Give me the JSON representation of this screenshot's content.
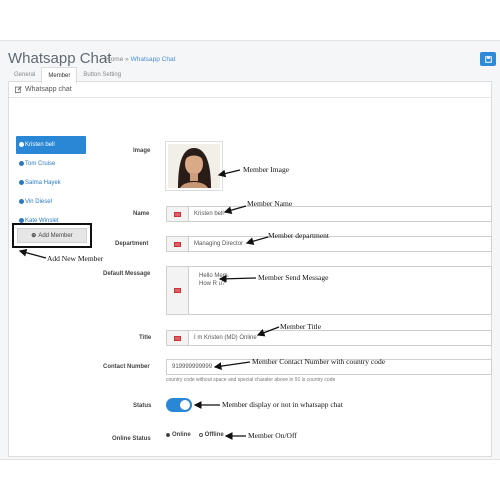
{
  "header": {
    "title": "Whatsapp Chat",
    "breadcrumb_home": "Home",
    "breadcrumb_sep": "»",
    "breadcrumb_current": "Whatsapp Chat"
  },
  "panel": {
    "title": "Whatsapp chat"
  },
  "tabs": [
    {
      "label": "General"
    },
    {
      "label": "Member"
    },
    {
      "label": "Button Setting"
    }
  ],
  "members": [
    {
      "label": "Kristen bell"
    },
    {
      "label": "Tom Cruise"
    },
    {
      "label": "Salma Hayek"
    },
    {
      "label": "Vin Diesel"
    },
    {
      "label": "Kate Winslet"
    }
  ],
  "add_member_label": "Add Member",
  "form": {
    "image_label": "Image",
    "name_label": "Name",
    "name_value": "Kristen bell",
    "department_label": "Department",
    "department_value": "Managing Director",
    "message_label": "Default Message",
    "message_line1": "Hello Mem.",
    "message_line2": "How R u?",
    "title_label": "Title",
    "title_value": "I m Kristen (MD) Online",
    "contact_label": "Contact Number",
    "contact_value": "919999999999",
    "contact_help": "country code without space and special charater above in 91 is country code",
    "status_label": "Status",
    "status_on": true,
    "online_status_label": "Online Status",
    "online_option": "Online",
    "offline_option": "Offline",
    "online_selected": "Online"
  },
  "annotations": {
    "member_image": "Member Image",
    "member_name": "Member Name",
    "member_department": "Member department",
    "member_send_message": "Member Send Message",
    "member_title": "Member Title",
    "member_contact": "Member Contact Number with country code",
    "member_display": "Member display or not in whatsapp chat",
    "member_onoff": "Member On/Off",
    "add_new_member": "Add New Member"
  },
  "colors": {
    "accent": "#2a87d6",
    "page_bg": "#f5f6f8",
    "flag": "#e35d6a"
  }
}
